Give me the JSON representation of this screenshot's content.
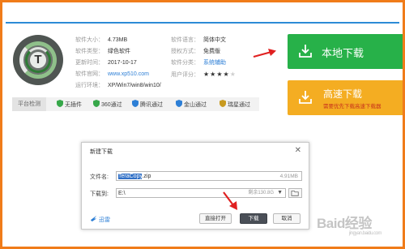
{
  "software": {
    "size_label": "软件大小：",
    "size": "4.73MB",
    "type_label": "软件类型：",
    "type": "绿色软件",
    "updated_label": "更新时间：",
    "updated": "2017-10-17",
    "website_label": "软件官网：",
    "website": "www.xp510.com",
    "env_label": "运行环境：",
    "env": "XP/Win7/win8/win10/",
    "lang_label": "软件语言：",
    "lang": "简体中文",
    "license_label": "授权方式：",
    "license": "免费版",
    "category_label": "软件分类：",
    "category": "系统辅助",
    "rating_label": "用户评分：",
    "rating": 4,
    "rating_max": 5,
    "logo_letter": "T"
  },
  "platform": {
    "label": "平台检测",
    "badges": [
      {
        "label": "无插件",
        "icon": "shield-check-icon",
        "color": "#37a84a"
      },
      {
        "label": "360通过",
        "icon": "shield-360-icon",
        "color": "#37a84a"
      },
      {
        "label": "腾讯通过",
        "icon": "shield-tencent-icon",
        "color": "#2d7fd6"
      },
      {
        "label": "金山通过",
        "icon": "shield-kingsoft-icon",
        "color": "#2d7fd6"
      },
      {
        "label": "瑞星通过",
        "icon": "shield-rising-icon",
        "color": "#c89a20"
      }
    ]
  },
  "buttons": {
    "local_download": "本地下载",
    "fast_download": "高速下载",
    "fast_note": "需要优先下载高速下载器"
  },
  "dialog": {
    "title": "新建下载",
    "filename_label": "文件名:",
    "filename_selected": "TeraCopy",
    "filename_ext": ".zip",
    "file_size": "4.91MB",
    "download_to_label": "下载到:",
    "path": "E:\\",
    "free_space": "剩余130.8G",
    "thunder_label": "迅雷",
    "open_directly": "直接打开",
    "download": "下载",
    "cancel": "取消"
  },
  "watermark": {
    "text": "Baid经验",
    "sub": "jingyan.baidu.com"
  },
  "colors": {
    "accent_border": "#f07c1a",
    "top_line": "#2d8bd6",
    "local_btn": "#27b149",
    "fast_btn": "#f4ad22",
    "arrow": "#e02020"
  }
}
